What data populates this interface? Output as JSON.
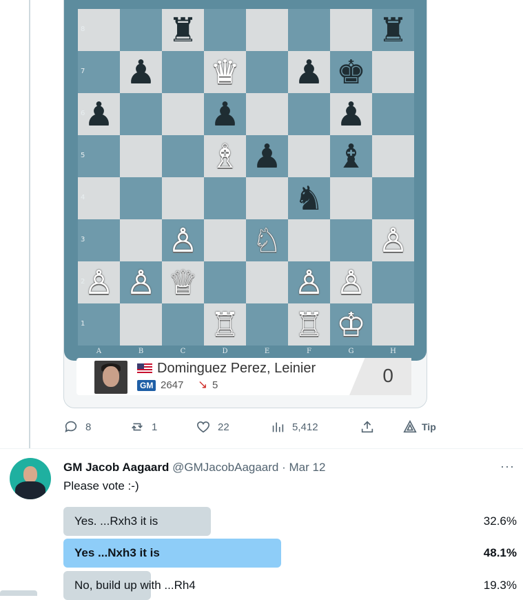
{
  "board": {
    "files": [
      "A",
      "B",
      "C",
      "D",
      "E",
      "F",
      "G",
      "H"
    ],
    "ranks": [
      "8",
      "7",
      "6",
      "5",
      "4",
      "3",
      "2",
      "1"
    ],
    "pieces": [
      {
        "sq": "c8",
        "color": "black",
        "glyph": "♜",
        "name": "black-rook"
      },
      {
        "sq": "h8",
        "color": "black",
        "glyph": "♜",
        "name": "black-rook"
      },
      {
        "sq": "b7",
        "color": "black",
        "glyph": "♟",
        "name": "black-pawn"
      },
      {
        "sq": "d7",
        "color": "white",
        "glyph": "♛",
        "name": "black-queen"
      },
      {
        "sq": "f7",
        "color": "black",
        "glyph": "♟",
        "name": "black-pawn"
      },
      {
        "sq": "g7",
        "color": "black",
        "glyph": "♚",
        "name": "black-king"
      },
      {
        "sq": "a6",
        "color": "black",
        "glyph": "♟",
        "name": "black-pawn"
      },
      {
        "sq": "d6",
        "color": "black",
        "glyph": "♟",
        "name": "black-pawn"
      },
      {
        "sq": "g6",
        "color": "black",
        "glyph": "♟",
        "name": "black-pawn"
      },
      {
        "sq": "d5",
        "color": "white",
        "glyph": "♗",
        "name": "white-bishop"
      },
      {
        "sq": "e5",
        "color": "black",
        "glyph": "♟",
        "name": "black-pawn"
      },
      {
        "sq": "g5",
        "color": "black",
        "glyph": "♝",
        "name": "black-bishop"
      },
      {
        "sq": "f4",
        "color": "black",
        "glyph": "♞",
        "name": "black-knight"
      },
      {
        "sq": "c3",
        "color": "white",
        "glyph": "♙",
        "name": "white-pawn"
      },
      {
        "sq": "e3",
        "color": "white",
        "glyph": "♘",
        "name": "white-knight"
      },
      {
        "sq": "h3",
        "color": "white",
        "glyph": "♙",
        "name": "white-pawn"
      },
      {
        "sq": "a2",
        "color": "white",
        "glyph": "♙",
        "name": "white-pawn"
      },
      {
        "sq": "b2",
        "color": "white",
        "glyph": "♙",
        "name": "white-pawn"
      },
      {
        "sq": "c2",
        "color": "white",
        "glyph": "♕",
        "name": "white-queen"
      },
      {
        "sq": "f2",
        "color": "white",
        "glyph": "♙",
        "name": "white-pawn"
      },
      {
        "sq": "g2",
        "color": "white",
        "glyph": "♙",
        "name": "white-pawn"
      },
      {
        "sq": "d1",
        "color": "white",
        "glyph": "♖",
        "name": "white-rook"
      },
      {
        "sq": "f1",
        "color": "white",
        "glyph": "♖",
        "name": "white-rook"
      },
      {
        "sq": "g1",
        "color": "white",
        "glyph": "♔",
        "name": "white-king"
      }
    ]
  },
  "player": {
    "name": "Dominguez Perez, Leinier",
    "title": "GM",
    "rating": "2647",
    "rating_change": "5",
    "score": "0"
  },
  "actions": {
    "replies": "8",
    "reposts": "1",
    "likes": "22",
    "views": "5,412",
    "tip": "Tip"
  },
  "tweet": {
    "author_name": "GM Jacob Aagaard",
    "handle": "@GMJacobAagaard",
    "separator": "·",
    "date": "Mar 12",
    "text": "Please vote :-)",
    "more": "···"
  },
  "poll": {
    "options": [
      {
        "label": "Yes. ...Rxh3 it is",
        "percent": "32.6%",
        "fraction": 0.326,
        "winner": false
      },
      {
        "label": "Yes ...Nxh3 it is",
        "percent": "48.1%",
        "fraction": 0.481,
        "winner": true
      },
      {
        "label": "No, build up with ...Rh4",
        "percent": "19.3%",
        "fraction": 0.193,
        "winner": false
      }
    ]
  }
}
